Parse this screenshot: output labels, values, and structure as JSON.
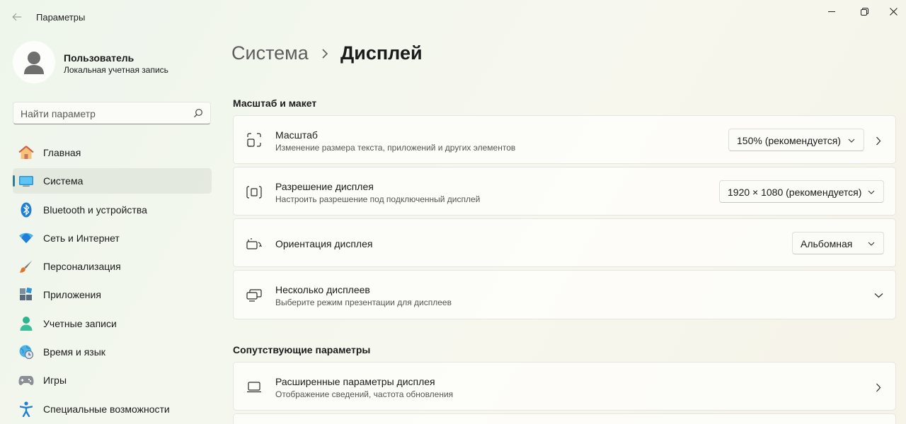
{
  "window": {
    "title": "Параметры",
    "back_icon": "arrow-left-icon",
    "controls": [
      "minimize-icon",
      "maximize-icon",
      "close-icon"
    ]
  },
  "user": {
    "name": "Пользователь",
    "account_type": "Локальная учетная запись"
  },
  "search": {
    "placeholder": "Найти параметр"
  },
  "sidebar": {
    "items": [
      {
        "label": "Главная",
        "icon": "home-icon",
        "active": false
      },
      {
        "label": "Система",
        "icon": "monitor-icon",
        "active": true
      },
      {
        "label": "Bluetooth и устройства",
        "icon": "bluetooth-icon",
        "active": false
      },
      {
        "label": "Сеть и Интернет",
        "icon": "wifi-icon",
        "active": false
      },
      {
        "label": "Персонализация",
        "icon": "brush-icon",
        "active": false
      },
      {
        "label": "Приложения",
        "icon": "apps-icon",
        "active": false
      },
      {
        "label": "Учетные записи",
        "icon": "person-icon",
        "active": false
      },
      {
        "label": "Время и язык",
        "icon": "globe-clock-icon",
        "active": false
      },
      {
        "label": "Игры",
        "icon": "gamepad-icon",
        "active": false
      },
      {
        "label": "Специальные возможности",
        "icon": "accessibility-icon",
        "active": false
      }
    ]
  },
  "breadcrumb": {
    "parent": "Система",
    "current": "Дисплей"
  },
  "sections": {
    "scale_layout": {
      "title": "Масштаб и макет",
      "scale": {
        "title": "Масштаб",
        "subtitle": "Изменение размера текста, приложений и других элементов",
        "value": "150% (рекомендуется)"
      },
      "resolution": {
        "title": "Разрешение дисплея",
        "subtitle": "Настроить разрешение под подключенный дисплей",
        "value": "1920 × 1080 (рекомендуется)"
      },
      "orientation": {
        "title": "Ориентация дисплея",
        "value": "Альбомная"
      },
      "multiple": {
        "title": "Несколько дисплеев",
        "subtitle": "Выберите режим презентации для дисплеев"
      }
    },
    "related": {
      "title": "Сопутствующие параметры",
      "advanced": {
        "title": "Расширенные параметры дисплея",
        "subtitle": "Отображение сведений, частота обновления"
      }
    }
  },
  "colors": {
    "accent": "#2f7d94"
  }
}
